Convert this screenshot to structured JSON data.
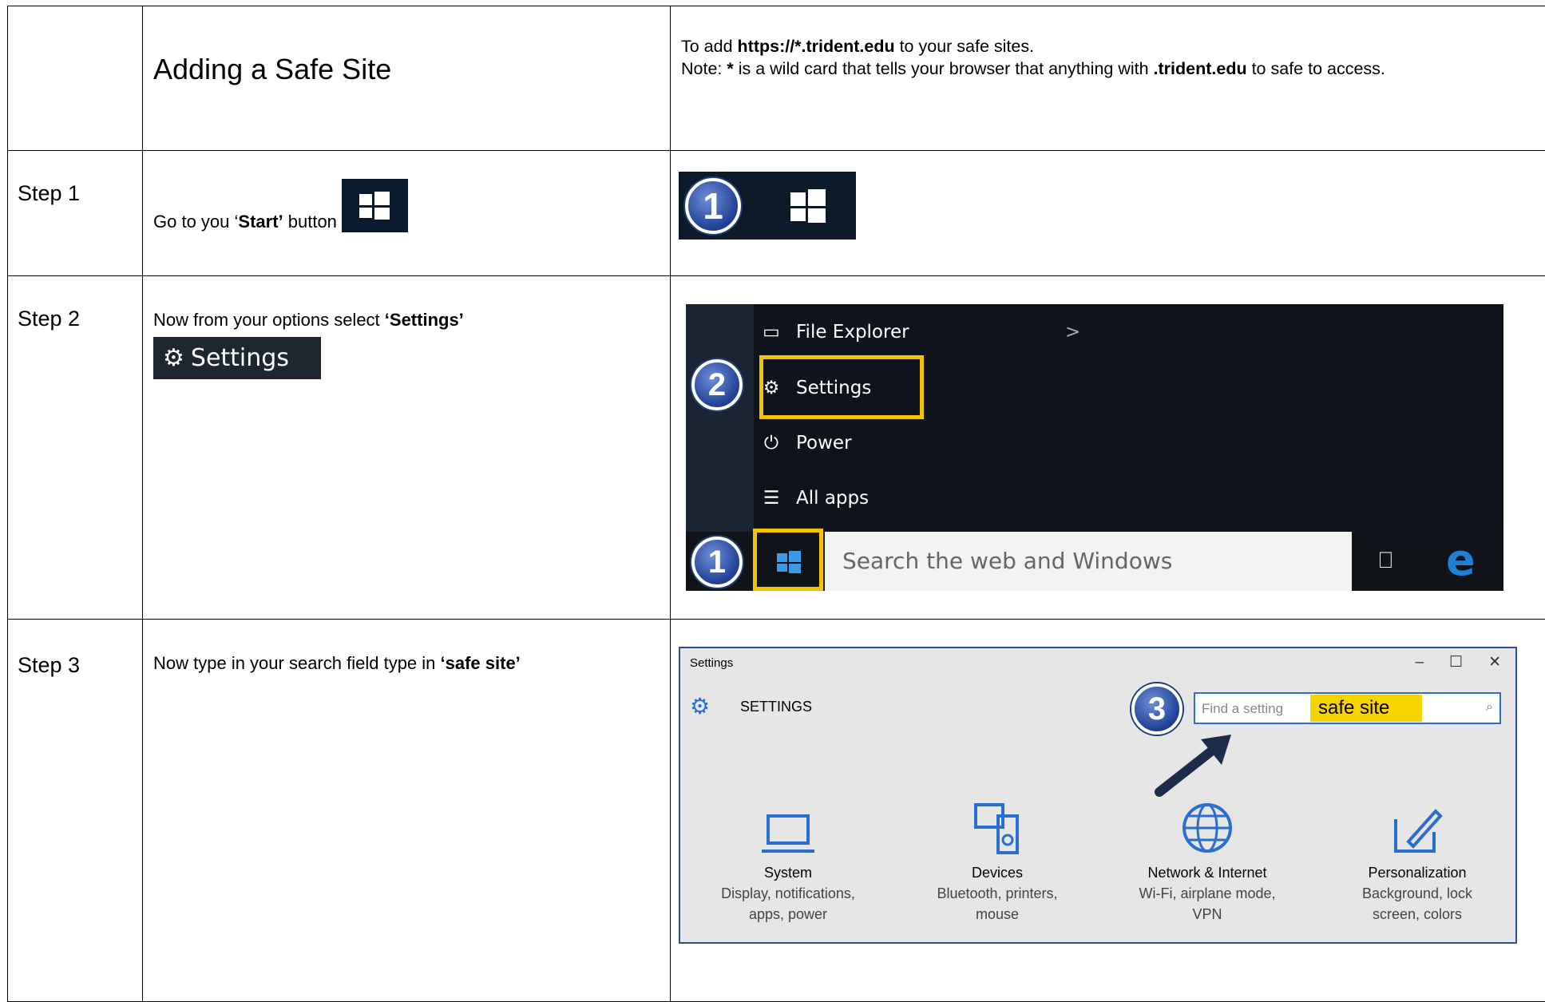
{
  "header": {
    "title": "Adding a Safe Site",
    "intro_prefix": "To add ",
    "intro_url": "https://*.trident.edu",
    "intro_suffix": " to your safe sites.",
    "note_prefix": "Note: ",
    "note_star": "*",
    "note_mid": " is a wild card that tells your browser that anything with ",
    "note_domain": ".trident.edu",
    "note_suffix": " to safe to access."
  },
  "steps": [
    {
      "label": "Step 1",
      "text_prefix": "Go to you ‘",
      "text_bold": "Start’",
      "text_suffix": " button",
      "badge": "1"
    },
    {
      "label": "Step 2",
      "text_prefix": "Now from your options select ",
      "text_bold": "‘Settings’",
      "button_label": "Settings",
      "badge": "2"
    },
    {
      "label": "Step 3",
      "text_prefix": "Now type in your search field type in ",
      "text_bold": "‘safe site’",
      "badge": "3"
    }
  ],
  "start_menu": {
    "items": [
      "File Explorer",
      "Settings",
      "Power",
      "All apps"
    ],
    "search_placeholder": "Search the web and Windows",
    "edge_glyph": "e",
    "chevron": ">"
  },
  "settings_window": {
    "window_title": "Settings",
    "heading": "SETTINGS",
    "search_placeholder": "Find a setting",
    "search_value": "safe site",
    "controls": [
      "–",
      "☐",
      "✕"
    ],
    "tiles": [
      {
        "title": "System",
        "desc1": "Display, notifications,",
        "desc2": "apps, power"
      },
      {
        "title": "Devices",
        "desc1": "Bluetooth, printers,",
        "desc2": "mouse"
      },
      {
        "title": "Network & Internet",
        "desc1": "Wi-Fi, airplane mode,",
        "desc2": "VPN"
      },
      {
        "title": "Personalization",
        "desc1": "Background, lock",
        "desc2": "screen, colors"
      }
    ]
  },
  "colors": {
    "highlight": "#f2c400",
    "badge": "#2a4ca8",
    "edge": "#1e7fd6"
  }
}
